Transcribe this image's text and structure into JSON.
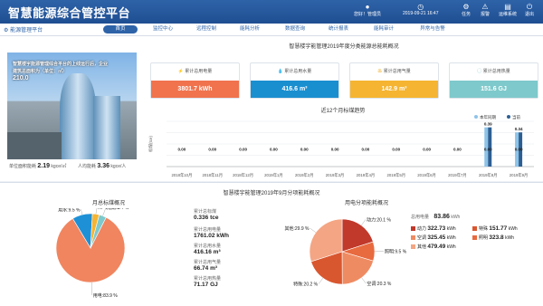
{
  "header": {
    "title": "智慧能源综合管控平台",
    "user": "您好！管理员",
    "datetime": "2019-09-21 16:47",
    "icons": [
      {
        "label": "任务",
        "icon": "gear-icon"
      },
      {
        "label": "报警",
        "icon": "bell-icon"
      },
      {
        "label": "运维系统",
        "icon": "monitor-icon"
      },
      {
        "label": "退出",
        "icon": "power-icon"
      }
    ]
  },
  "nav": {
    "brand": "能源管理平台",
    "tabs": [
      "首页",
      "监控中心",
      "远程控制",
      "能耗分析",
      "数据查询",
      "统计报表",
      "能耗审计",
      "异常与告警"
    ]
  },
  "top": {
    "overlay_lines": [
      "智慧楼宇能源管理综合平台的上线运行后，企业",
      "建筑总面积为（单位：㎡）",
      "210.0"
    ],
    "area_label": "单位面积能耗",
    "area_value": "2.19",
    "area_unit": "kgce/㎡",
    "person_label": "人均能耗",
    "person_value": "3.36",
    "person_unit": "kgce/人",
    "summary_title": "智慧楼宇能管理2019年度分类能源总能耗概况",
    "cards": [
      {
        "label": "累计总用电量",
        "value": "3801.7 kWh",
        "color": "#f0734e",
        "icon": "lightning-icon",
        "iconColor": "#e8542a"
      },
      {
        "label": "累计总用水量",
        "value": "416.6 m³",
        "color": "#1a8fd0",
        "icon": "water-drop-icon",
        "iconColor": "#1a8fd0"
      },
      {
        "label": "累计总用气量",
        "value": "142.9 m³",
        "color": "#f5b431",
        "icon": "gas-icon",
        "iconColor": "#f0a000"
      },
      {
        "label": "累计总用热量",
        "value": "151.6 GJ",
        "color": "#7ec9cb",
        "icon": "heat-icon",
        "iconColor": "#6ab8bb"
      }
    ]
  },
  "bar_chart_title": "近12个月标煤趋势",
  "chart_data": [
    {
      "type": "bar",
      "title": "近12个月标煤趋势",
      "ylabel": "标煤(tce)",
      "categories": [
        "2018年10月",
        "2018年11月",
        "2018年12月",
        "2019年1月",
        "2019年2月",
        "2019年3月",
        "2019年4月",
        "2019年5月",
        "2019年6月",
        "2019年7月",
        "2019年8月",
        "2019年9月"
      ],
      "series": [
        {
          "name": "本年同期",
          "values": [
            0,
            0,
            0,
            0,
            0,
            0,
            0,
            0,
            0,
            0,
            0.39,
            0.34
          ],
          "color": "#8ec3e8"
        },
        {
          "name": "当前",
          "values": [
            0,
            0,
            0,
            0,
            0,
            0,
            0,
            0,
            0,
            0,
            0.39,
            0.34
          ],
          "color": "#2d5f93"
        }
      ],
      "data_labels": [
        "0.00",
        "0.00",
        "0.00",
        "0.00",
        "0.00",
        "0.00",
        "0.00",
        "0.00",
        "0.00",
        "0.00",
        "0.00",
        "0.00"
      ],
      "top_labels": {
        "10": "0.39",
        "11": "0.34"
      },
      "ylim": [
        0,
        0.45
      ],
      "legend": "top-right"
    },
    {
      "type": "pie",
      "title": "月总标煤概况",
      "labels": [
        "用电",
        "用水",
        "用气",
        "用热"
      ],
      "values": [
        83.9,
        9.5,
        3.2,
        3.4
      ],
      "display": [
        "用电:83.9 %",
        "用水:9.5 %",
        "用气:3.2 %",
        "用热:3.4 %"
      ],
      "colors": [
        "#f0855f",
        "#1e90d6",
        "#f5b431",
        "#7ec9cb"
      ]
    },
    {
      "type": "pie",
      "title": "用电分项能耗概况",
      "labels": [
        "动力",
        "照明",
        "空调",
        "特殊",
        "其他"
      ],
      "values": [
        20.1,
        9.5,
        20.3,
        20.2,
        29.9
      ],
      "display": [
        "动力:20.1 %",
        "照明:9.5 %",
        "空调:20.3 %",
        "特殊:20.2 %",
        "其他:29.9 %"
      ],
      "colors": [
        "#c0392b",
        "#e86a3f",
        "#ef8b62",
        "#d9572f",
        "#f4a583"
      ]
    }
  ],
  "bottom": {
    "title": "智慧楼宇能管理2019年9月分项能耗概况",
    "left_kv": [
      {
        "label": "累计总标煤",
        "value": "0.336 tce"
      },
      {
        "label": "累计总用电量",
        "value": "1761.02 kWh"
      },
      {
        "label": "累计总用水量",
        "value": "416.16 m³"
      },
      {
        "label": "累计总用气量",
        "value": "66.74 m³"
      },
      {
        "label": "累计总用热量",
        "value": "71.17 GJ"
      }
    ],
    "right_total_label": "总用电量",
    "right_total_value": "83.86",
    "right_total_unit": "kWh",
    "right_items": [
      {
        "label": "动力",
        "value": "322.73",
        "unit": "kWh",
        "color": "#c0392b"
      },
      {
        "label": "特殊",
        "value": "151.77",
        "unit": "kWh",
        "color": "#d9572f"
      },
      {
        "label": "空调",
        "value": "325.45",
        "unit": "kWh",
        "color": "#ef8b62"
      },
      {
        "label": "照明",
        "value": "323.8",
        "unit": "kWh",
        "color": "#e86a3f"
      },
      {
        "label": "其他",
        "value": "479.49",
        "unit": "kWh",
        "color": "#f4a583"
      }
    ]
  }
}
